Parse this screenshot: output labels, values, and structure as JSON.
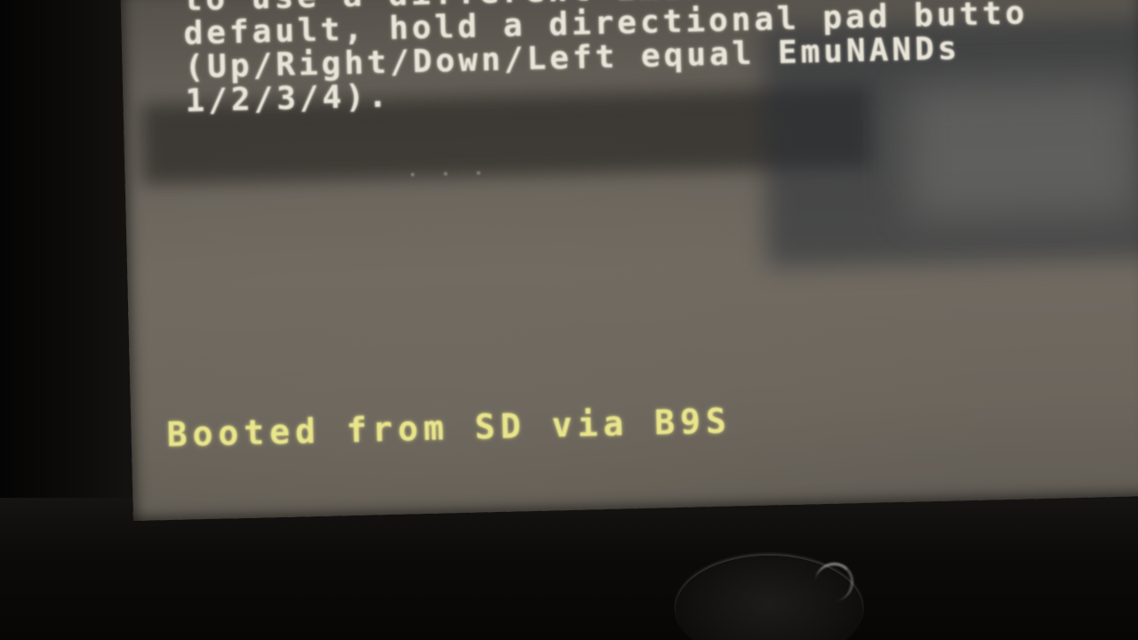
{
  "screen": {
    "console_lines": [
      "to use a different EmuNAND from the",
      "default, hold a directional pad butto",
      "(Up/Right/Down/Left equal EmuNANDs",
      "1/2/3/4)."
    ],
    "boot_status": "Booted from SD via B9S",
    "text_color": "#e8e4d8",
    "status_color": "#e9e58a"
  },
  "device": {
    "control_icon": "circle-pad-icon"
  }
}
